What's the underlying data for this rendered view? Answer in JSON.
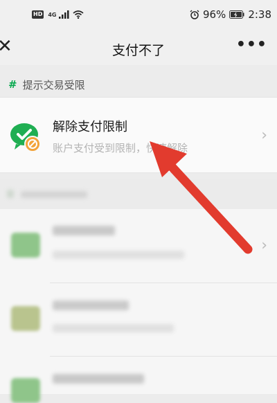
{
  "status_bar": {
    "hd": "HD",
    "network": "4G",
    "battery_percent": "96%",
    "time": "2:38"
  },
  "nav": {
    "title": "支付不了",
    "close_icon": "close-icon",
    "more_icon": "more-icon"
  },
  "section": {
    "marker": "#",
    "title": "提示交易受限"
  },
  "item": {
    "title": "解除支付限制",
    "subtitle": "账户支付受到限制，快速解除"
  },
  "colors": {
    "accent_green": "#07a94e",
    "arrow_red": "#e23b2e"
  }
}
